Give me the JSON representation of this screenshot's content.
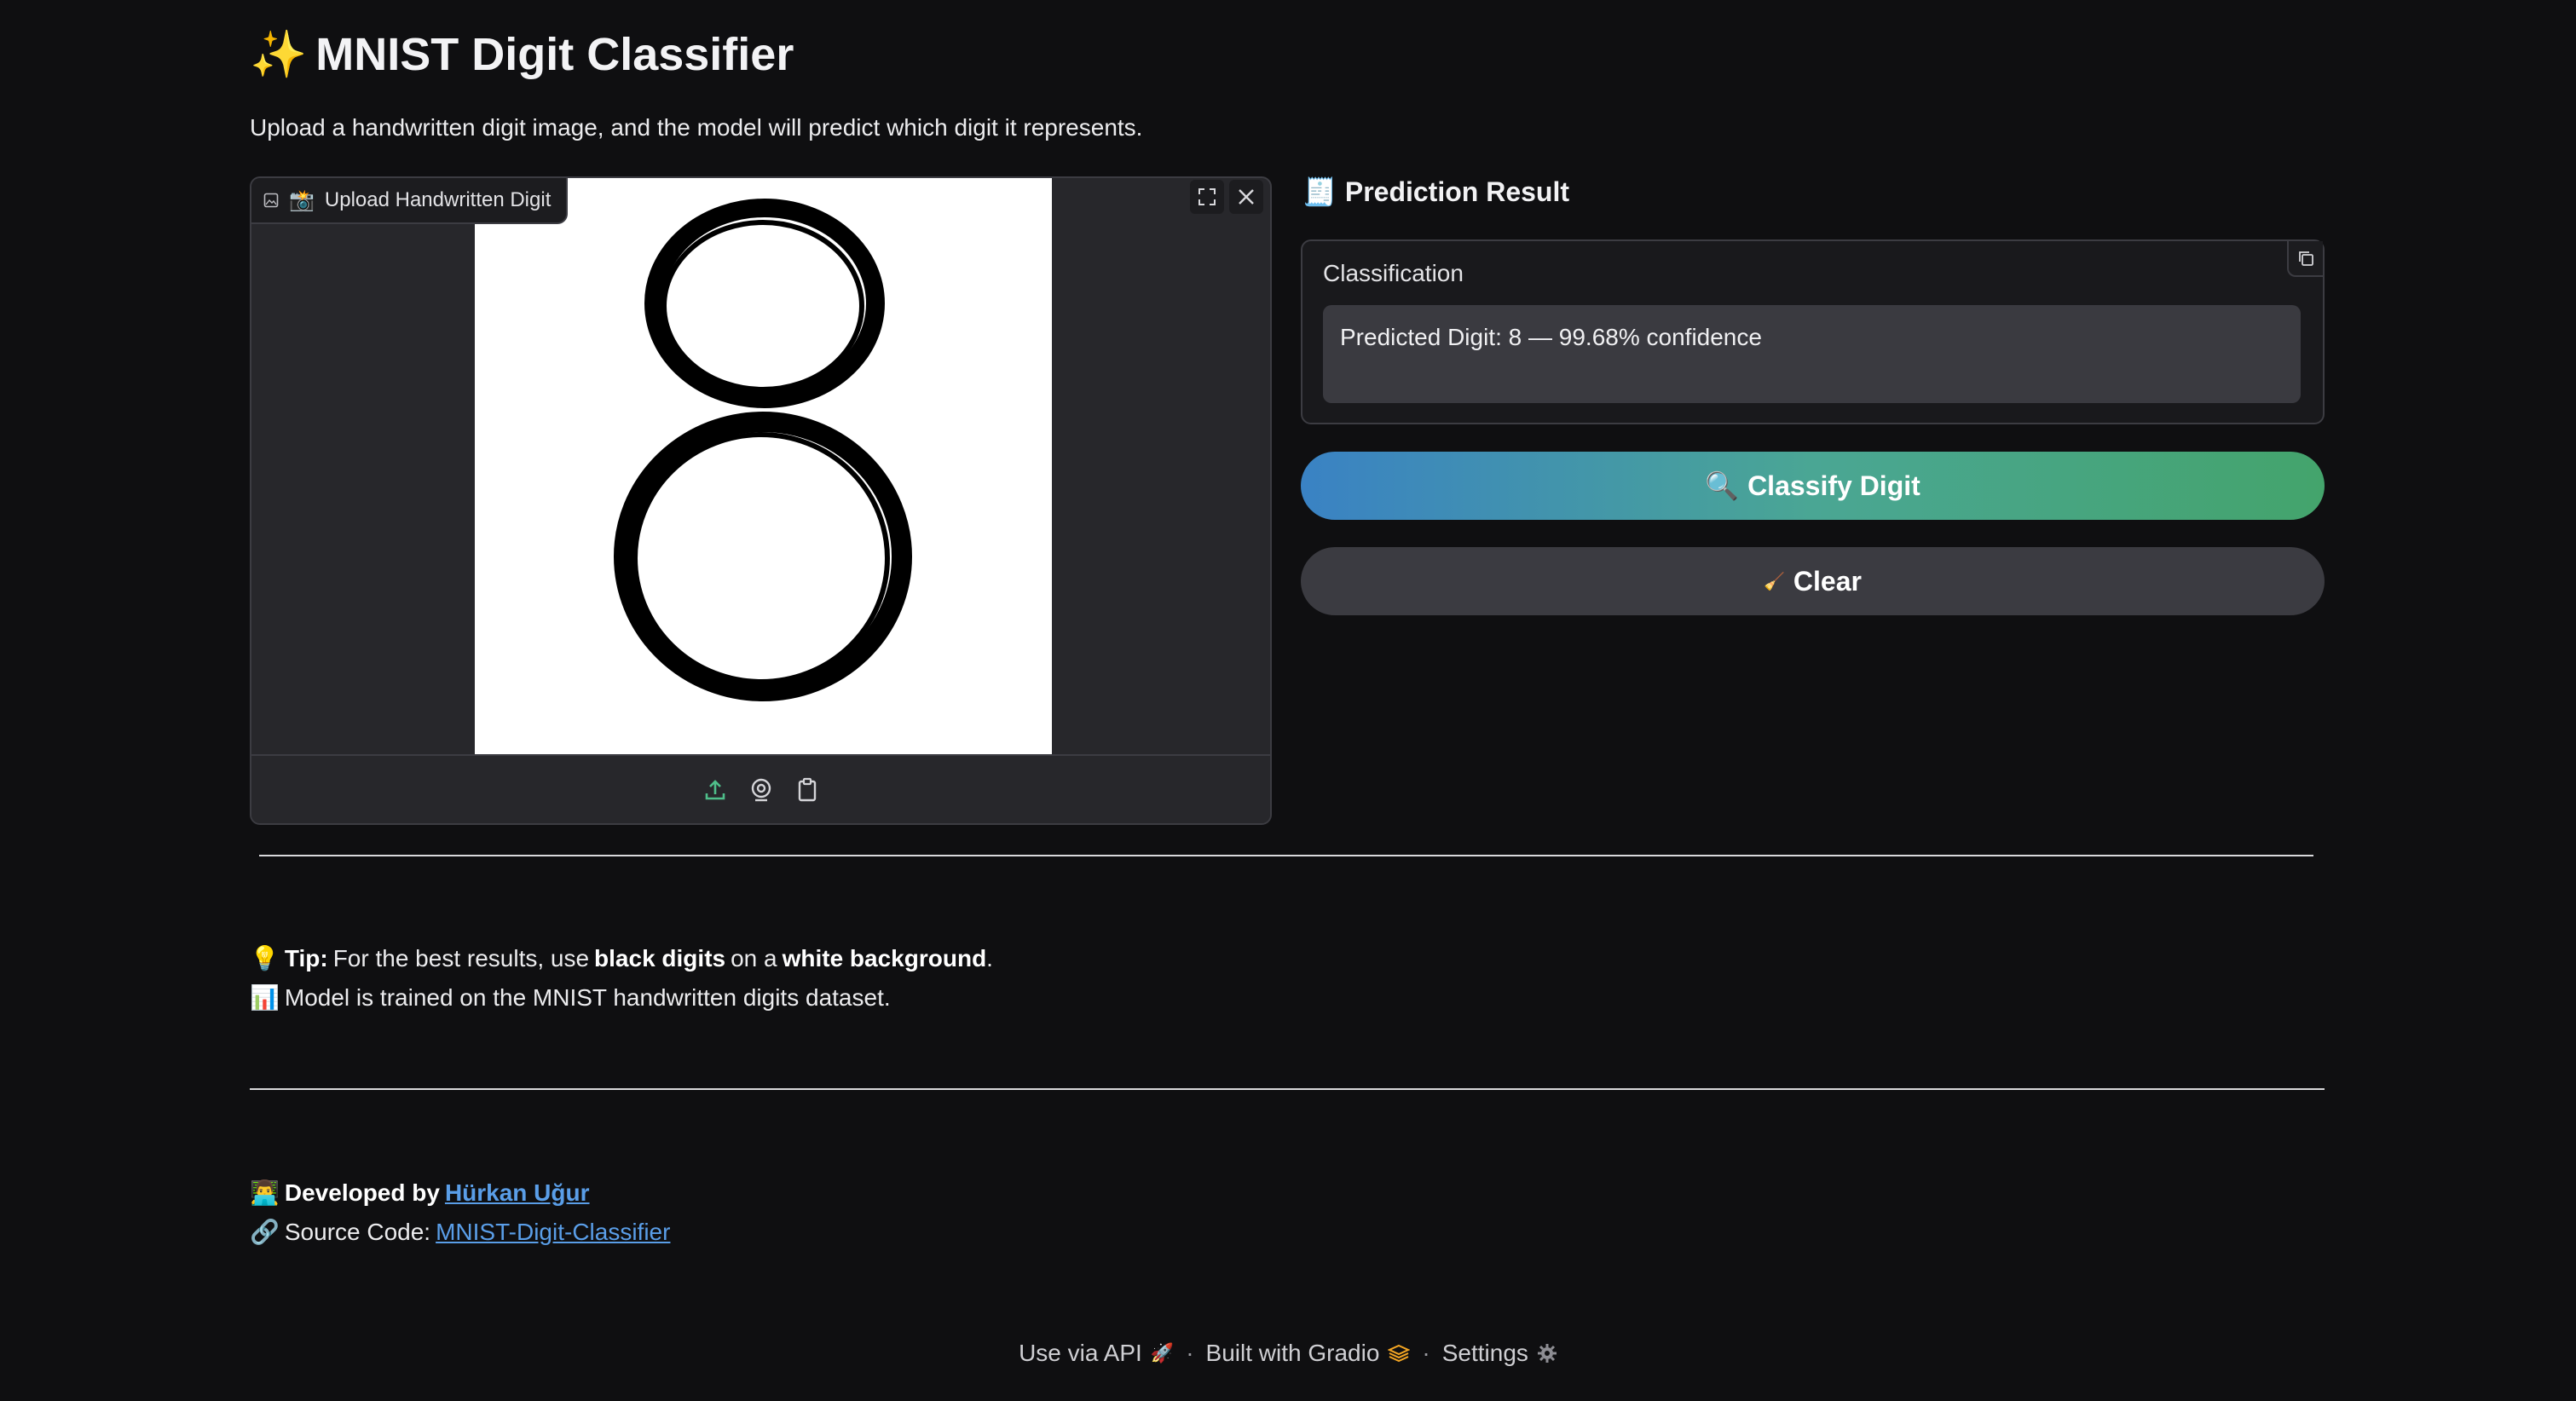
{
  "header": {
    "title": "MNIST Digit Classifier",
    "subtitle": "Upload a handwritten digit image, and the model will predict which digit it represents."
  },
  "image_input": {
    "label": "Upload Handwritten Digit",
    "label_icon": "image-icon",
    "preview_digit": "8",
    "tools": [
      "fullscreen-icon",
      "close-icon"
    ],
    "sources": [
      "upload-icon",
      "webcam-icon",
      "clipboard-icon"
    ]
  },
  "prediction": {
    "heading": "Prediction Result",
    "panel_label": "Classification",
    "result_text": "Predicted Digit: 8 — 99.68% confidence"
  },
  "buttons": {
    "classify_label": "Classify Digit",
    "clear_label": "Clear"
  },
  "info": {
    "tip_prefix": "Tip:",
    "tip_text_1": "For the best results, use",
    "tip_bold_1": "black digits",
    "tip_text_2": "on a",
    "tip_bold_2": "white background",
    "tip_text_3": ".",
    "model_text": "Model is trained on the MNIST handwritten digits dataset."
  },
  "credits": {
    "developed_by": "Developed by",
    "author": "Hürkan Uğur",
    "source_label": "Source Code:",
    "source_link": "MNIST-Digit-Classifier"
  },
  "footer": {
    "api": "Use via API",
    "built": "Built with Gradio",
    "settings": "Settings",
    "separator": "·"
  },
  "colors": {
    "background": "#0f0f11",
    "primary_gradient_start": "#3a82c4",
    "primary_gradient_end": "#44a46c",
    "link": "#5a9ee8"
  }
}
